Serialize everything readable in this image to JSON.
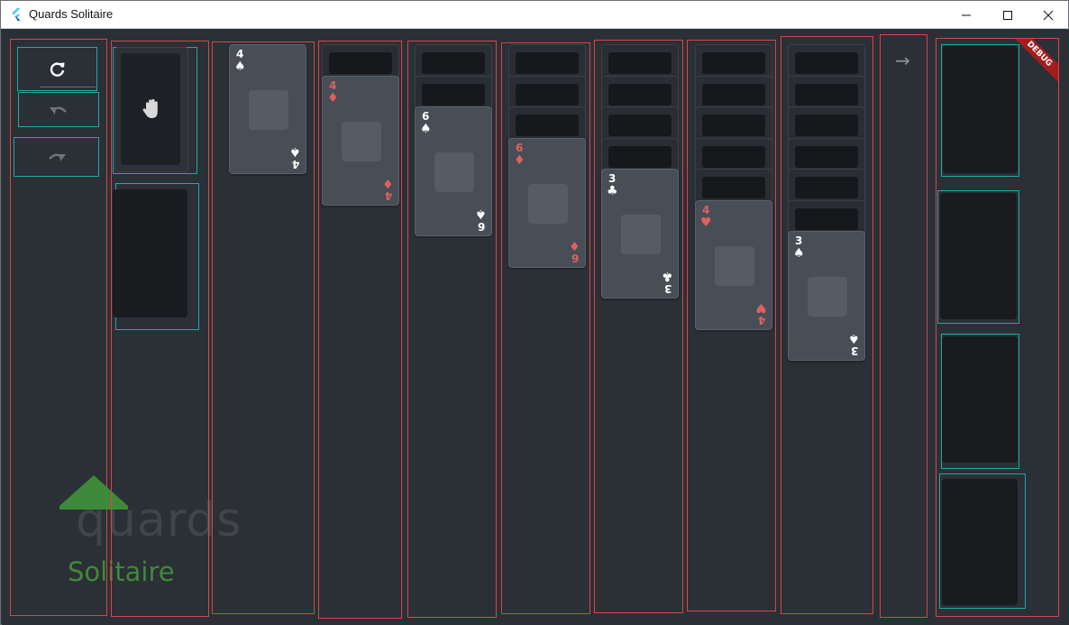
{
  "window": {
    "title": "Quards Solitaire",
    "app_icon": "flutter-icon",
    "controls": [
      "minimize-icon",
      "maximize-icon",
      "close-icon"
    ]
  },
  "toolbar": {
    "restart_icon": "refresh-icon",
    "undo_icon": "undo-icon",
    "redo_icon": "redo-icon"
  },
  "stock": {
    "icon": "hand-icon"
  },
  "next_arrow": "→",
  "logo": {
    "word": "quards",
    "sub": "Solitaire"
  },
  "debug_banner": "DEBUG",
  "tableau": [
    {
      "face_down": 0,
      "cards": [
        {
          "rank": "4",
          "suit": "♠",
          "color": "black"
        }
      ]
    },
    {
      "face_down": 1,
      "cards": [
        {
          "rank": "4",
          "suit": "♦",
          "color": "red"
        }
      ]
    },
    {
      "face_down": 2,
      "cards": [
        {
          "rank": "6",
          "suit": "♠",
          "color": "black"
        }
      ]
    },
    {
      "face_down": 3,
      "cards": [
        {
          "rank": "6",
          "suit": "♦",
          "color": "red"
        }
      ]
    },
    {
      "face_down": 4,
      "cards": [
        {
          "rank": "3",
          "suit": "♣",
          "color": "black"
        }
      ]
    },
    {
      "face_down": 5,
      "cards": [
        {
          "rank": "4",
          "suit": "♥",
          "color": "red"
        }
      ]
    },
    {
      "face_down": 6,
      "cards": [
        {
          "rank": "3",
          "suit": "♠",
          "color": "black"
        }
      ]
    }
  ],
  "colors": {
    "background": "#2b2f36",
    "red_suit": "#e06060",
    "border_red": "#d84545",
    "border_cyan": "#1fa9a9",
    "logo_green": "#3e8a3a"
  }
}
